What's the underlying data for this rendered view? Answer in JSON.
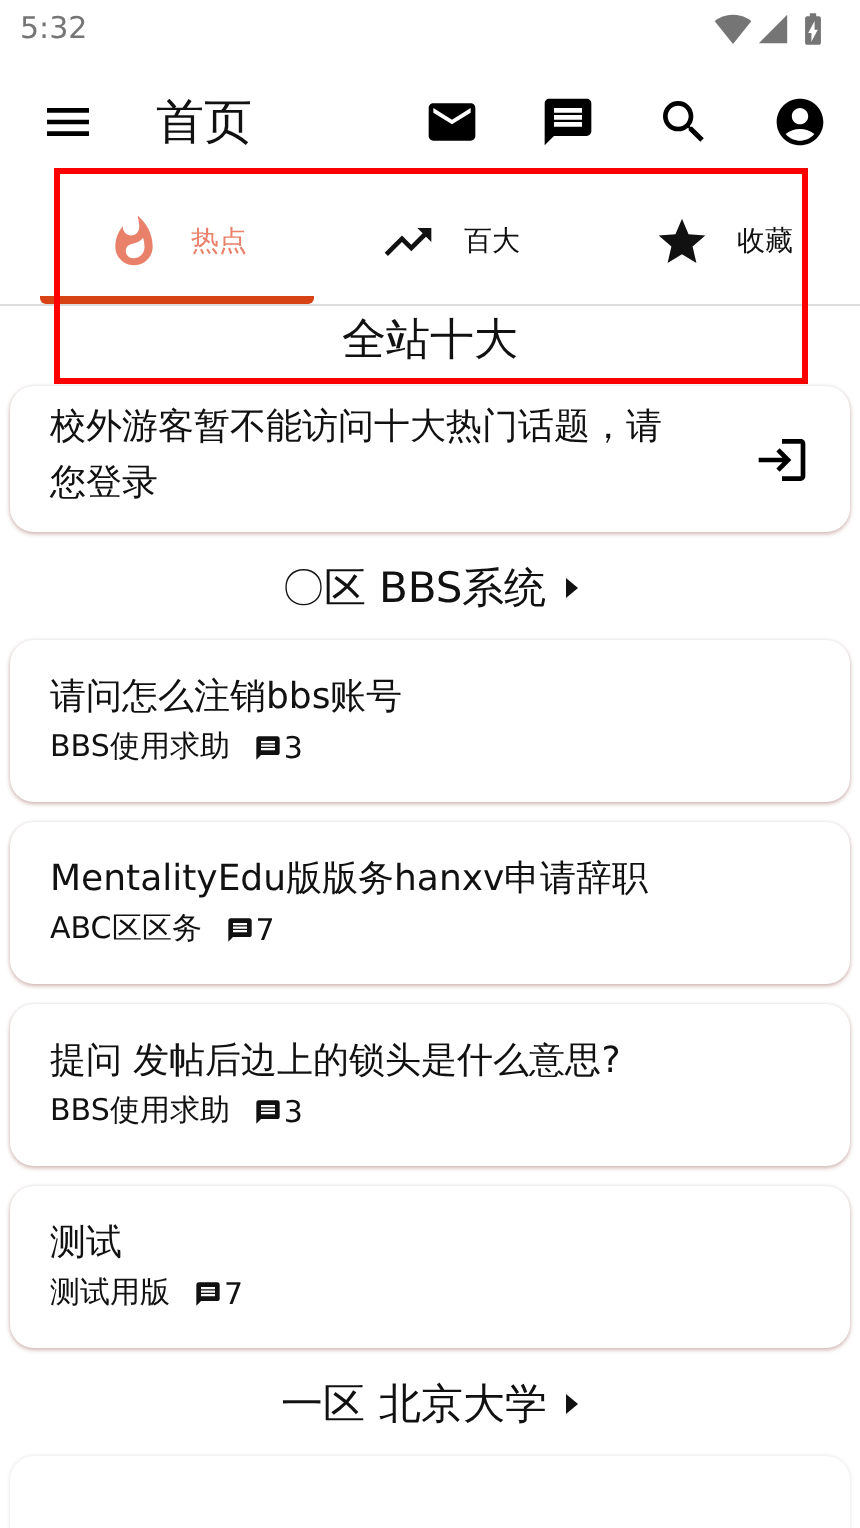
{
  "status_bar": {
    "time": "5:32"
  },
  "app_bar": {
    "title": "首页"
  },
  "tabs": [
    {
      "label": "热点",
      "selected": true
    },
    {
      "label": "百大",
      "selected": false
    },
    {
      "label": "收藏",
      "selected": false
    }
  ],
  "heading": "全站十大",
  "login_notice": {
    "text": "校外游客暂不能访问十大热门话题，请您登录"
  },
  "sections": [
    {
      "title": "〇区 BBS系统",
      "posts": [
        {
          "title": "请问怎么注销bbs账号",
          "board": "BBS使用求助",
          "comments": "3"
        },
        {
          "title": "MentalityEdu版版务hanxv申请辞职",
          "board": "ABC区区务",
          "comments": "7"
        },
        {
          "title": "提问 发帖后边上的锁头是什么意思?",
          "board": "BBS使用求助",
          "comments": "3"
        },
        {
          "title": "测试",
          "board": "测试用版",
          "comments": "7"
        }
      ]
    },
    {
      "title": "一区 北京大学"
    }
  ]
}
